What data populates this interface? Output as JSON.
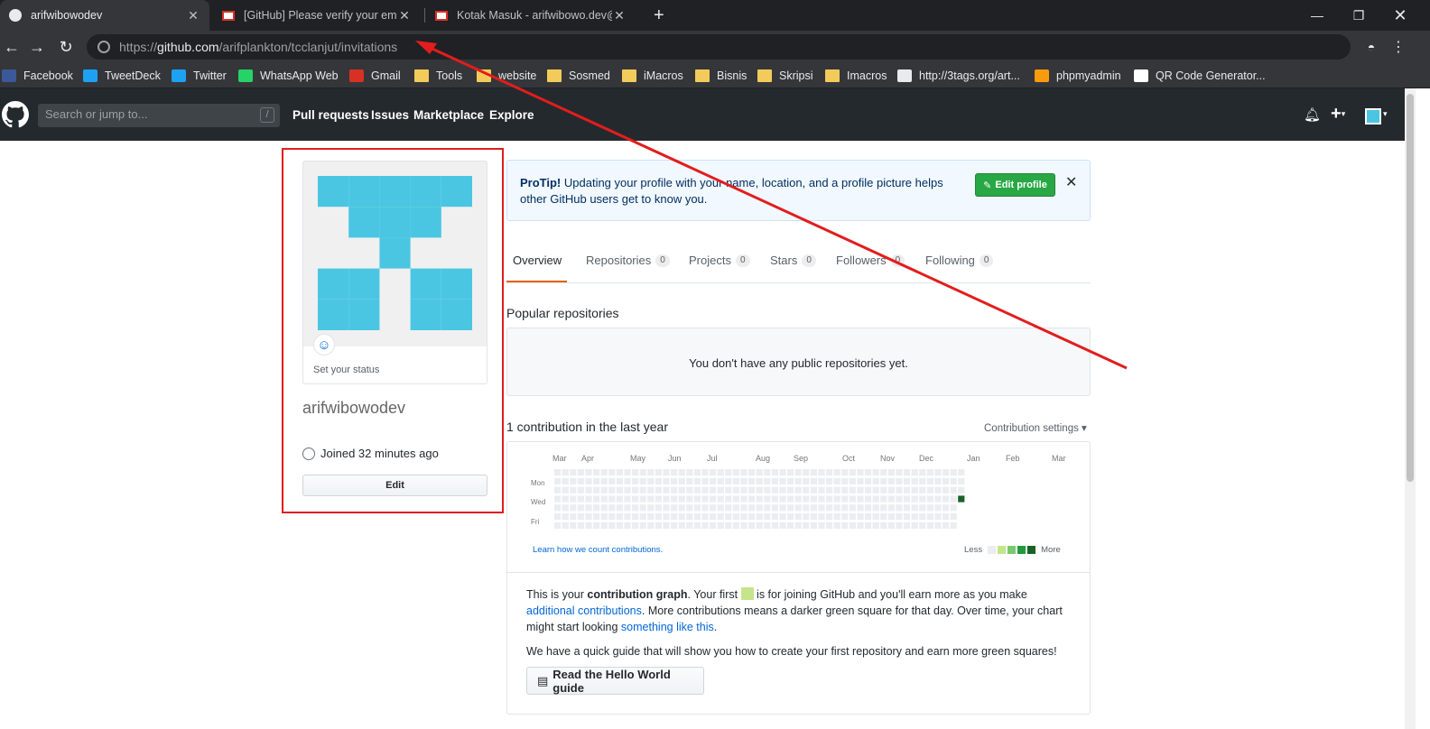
{
  "browser": {
    "tabs": [
      {
        "title": "arifwibowodev",
        "active": true,
        "icon": "github-icon"
      },
      {
        "title": "[GitHub] Please verify your email",
        "active": false,
        "icon": "gmail-icon"
      },
      {
        "title": "Kotak Masuk - arifwibowo.dev@g",
        "active": false,
        "icon": "gmail-icon"
      }
    ],
    "new_tab": "+",
    "url_prefix": "https://",
    "url_host": "github.com",
    "url_path": "/arifplankton/tcclanjut/invitations",
    "bookmarks": [
      {
        "label": "Facebook",
        "icon": "facebook-icon",
        "color": "#3b5998"
      },
      {
        "label": "TweetDeck",
        "icon": "tweetdeck-icon",
        "color": "#1da1f2"
      },
      {
        "label": "Twitter",
        "icon": "twitter-icon",
        "color": "#1da1f2"
      },
      {
        "label": "WhatsApp Web",
        "icon": "whatsapp-icon",
        "color": "#25d366"
      },
      {
        "label": "Gmail",
        "icon": "gmail-icon",
        "color": "#d93025"
      },
      {
        "label": "Tools",
        "icon": "folder-icon",
        "color": "#f3cb5b"
      },
      {
        "label": "website",
        "icon": "folder-icon",
        "color": "#f3cb5b"
      },
      {
        "label": "Sosmed",
        "icon": "folder-icon",
        "color": "#f3cb5b"
      },
      {
        "label": "iMacros",
        "icon": "folder-icon",
        "color": "#f3cb5b"
      },
      {
        "label": "Bisnis",
        "icon": "folder-icon",
        "color": "#f3cb5b"
      },
      {
        "label": "Skripsi",
        "icon": "folder-icon",
        "color": "#f3cb5b"
      },
      {
        "label": "Imacros",
        "icon": "folder-icon",
        "color": "#f3cb5b"
      },
      {
        "label": "http://3tags.org/art...",
        "icon": "page-icon",
        "color": "#e8eaed"
      },
      {
        "label": "phpmyadmin",
        "icon": "phpmyadmin-icon",
        "color": "#f89c0e"
      },
      {
        "label": "QR Code Generator...",
        "icon": "qr-icon",
        "color": "#ffffff"
      }
    ]
  },
  "gh_header": {
    "search_placeholder": "Search or jump to...",
    "search_shortcut": "/",
    "nav": [
      "Pull requests",
      "Issues",
      "Marketplace",
      "Explore"
    ]
  },
  "sidebar": {
    "set_status": "Set your status",
    "username": "arifwibowodev",
    "joined": "Joined 32 minutes ago",
    "edit_button": "Edit",
    "avatar_color": "#4ac6e3"
  },
  "protip": {
    "bold": "ProTip!",
    "text": " Updating your profile with your name, location, and a profile picture helps other GitHub users get to know you.",
    "button": "Edit profile",
    "close": "✕"
  },
  "tabs": [
    {
      "label": "Overview",
      "count": null,
      "selected": true
    },
    {
      "label": "Repositories",
      "count": "0",
      "selected": false
    },
    {
      "label": "Projects",
      "count": "0",
      "selected": false
    },
    {
      "label": "Stars",
      "count": "0",
      "selected": false
    },
    {
      "label": "Followers",
      "count": "0",
      "selected": false
    },
    {
      "label": "Following",
      "count": "0",
      "selected": false
    }
  ],
  "popular": {
    "title": "Popular repositories",
    "empty": "You don't have any public repositories yet."
  },
  "contributions": {
    "title": "1 contribution in the last year",
    "settings": "Contribution settings ▾",
    "months": [
      "Mar",
      "Apr",
      "May",
      "Jun",
      "Jul",
      "Aug",
      "Sep",
      "Oct",
      "Nov",
      "Dec",
      "Jan",
      "Feb",
      "Mar"
    ],
    "days": [
      "Mon",
      "Wed",
      "Fri"
    ],
    "learn": "Learn how we count contributions.",
    "legend_less": "Less",
    "legend_more": "More",
    "legend_colors": [
      "#ebedf0",
      "#c6e48b",
      "#7bc96f",
      "#239a3b",
      "#196127"
    ],
    "empty_color": "#ebedf0",
    "active_color": "#196127",
    "grid_weeks": 53,
    "active_cell": {
      "week": 52,
      "day": 3
    }
  },
  "info": {
    "p1_a": "This is your ",
    "p1_b": "contribution graph",
    "p1_c": ". Your first ",
    "p1_d": " is for joining GitHub and you'll earn more as you make ",
    "p1_link1": "additional contributions",
    "p1_e": ". More contributions means a darker green square for that day. Over time, your chart might start looking ",
    "p1_link2": "something like this",
    "p1_f": ".",
    "p2": "We have a quick guide that will show you how to create your first repository and earn more green squares!",
    "button": "Read the Hello World guide"
  }
}
